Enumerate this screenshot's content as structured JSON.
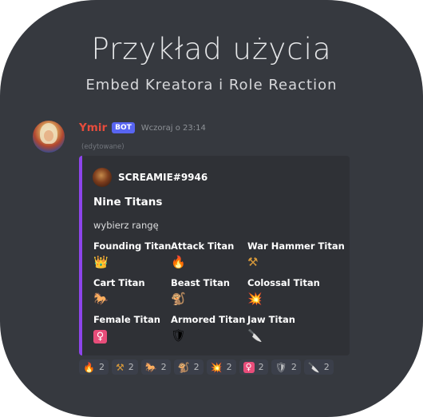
{
  "header": {
    "title": "Przykład użycia",
    "subtitle": "Embed Kreatora i Role Reaction"
  },
  "message": {
    "author": "Ymir",
    "bot_tag": "BOT",
    "timestamp": "Wczoraj o 23:14",
    "edited": "(edytowane)",
    "colors": {
      "username": "#e74c3c",
      "embed_accent": "#8e44ec",
      "bot_tag": "#5865f2"
    }
  },
  "embed": {
    "author": "SCREAMIE#9946",
    "title": "Nine Titans",
    "description": "wybierz rangę",
    "fields": [
      {
        "name": "Founding Titan",
        "emoji": "👑",
        "icon": "crown-icon"
      },
      {
        "name": "Attack Titan",
        "emoji": "🔥",
        "icon": "fire-icon"
      },
      {
        "name": "War Hammer Titan",
        "emoji": "⚒",
        "icon": "hammer-pick-icon"
      },
      {
        "name": "Cart Titan",
        "emoji": "🐎",
        "icon": "horse-icon"
      },
      {
        "name": "Beast Titan",
        "emoji": "🐒",
        "icon": "monkey-icon"
      },
      {
        "name": "Colossal Titan",
        "emoji": "💥",
        "icon": "collision-icon"
      },
      {
        "name": "Female Titan",
        "emoji": "♀",
        "icon": "female-sign-icon"
      },
      {
        "name": "Armored Titan",
        "emoji": "🛡",
        "icon": "shield-icon"
      },
      {
        "name": "Jaw Titan",
        "emoji": "🔪",
        "icon": "knife-icon"
      }
    ]
  },
  "reactions": [
    {
      "emoji": "🔥",
      "count": "2",
      "icon": "fire-icon"
    },
    {
      "emoji": "⚒",
      "count": "2",
      "icon": "hammer-pick-icon"
    },
    {
      "emoji": "🐎",
      "count": "2",
      "icon": "horse-icon"
    },
    {
      "emoji": "🐒",
      "count": "2",
      "icon": "monkey-icon"
    },
    {
      "emoji": "💥",
      "count": "2",
      "icon": "collision-icon"
    },
    {
      "emoji": "♀",
      "count": "2",
      "icon": "female-sign-icon"
    },
    {
      "emoji": "🛡",
      "count": "2",
      "icon": "shield-icon"
    },
    {
      "emoji": "🔪",
      "count": "2",
      "icon": "knife-icon"
    }
  ]
}
